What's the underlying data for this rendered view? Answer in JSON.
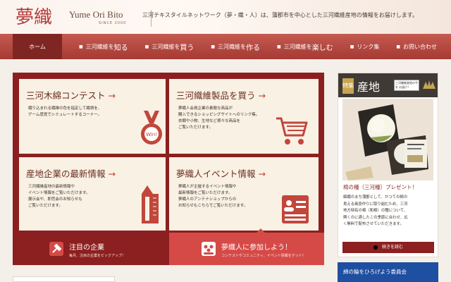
{
  "header": {
    "logo_kanji": "夢織人",
    "logo_name": "Yume Ori Bito",
    "logo_since": "SINCE 2000",
    "tagline": "三河テキスタイルネットワーク（夢・織・人）は、蒲郡市を中心とした三河織維産地の情報をお届けします。"
  },
  "nav": {
    "home": "ホーム",
    "items": [
      {
        "small": "三河織維を",
        "big": "知る"
      },
      {
        "small": "三河織維を",
        "big": "買う"
      },
      {
        "small": "三河織維を",
        "big": "作る"
      },
      {
        "small": "三河織維を",
        "big": "楽しむ"
      },
      {
        "small": "",
        "big": "リンク集"
      },
      {
        "small": "",
        "big": "お問い合わせ"
      }
    ]
  },
  "cards": {
    "c1": {
      "title": "三河木綿コンテスト",
      "desc": "織り込まれる織維の色を指定して織柄を、\nゲーム感覚でシミュレートするコーナー。",
      "icon_label": "Win!"
    },
    "c2": {
      "title": "三河織維製品を買う",
      "desc": "夢織人会員企業の素敵な商品が\n購入できるショッピングサイトへのリンク集。\n衣類や小物、生地など様々な商品を\nご覧いただけます。"
    },
    "c3": {
      "title": "産地企業の最新情報",
      "desc": "三河繊維産地の最新情報や\nイベント情報をご覧いただけます。\n展示会や、即売会のお知らせも\nご覧いただけます。"
    },
    "c4": {
      "title": "夢織人イベント情報",
      "desc": "夢織人が主催するイベント情報や\n最新情報をご覧いただけます。\n夢織人のアンテナショップからの\nお知らせもこちらでご覧いただけます。"
    }
  },
  "bottom": {
    "b1": {
      "title": "注目の企業",
      "sub": "毎月、注目の企業をピックアップ！"
    },
    "b2": {
      "title": "夢織人に参加しよう！",
      "sub": "コンテストやコミュニティ、イベント情報をゲット！"
    }
  },
  "sidebar": {
    "badge": "特集",
    "heading": "産地",
    "note": "三河織維産地の今を お届け！",
    "caption_title": "棉の種（三河種）プレゼント！",
    "caption_body": "綿織のまち蒲郡として、かつての棉の\n見える風景作りに取り組むため、三河\n地方特有の棉（和棉）の種について、\n興くのに適したこの季節に合わせ、広\nく無料で配布させていただきます。",
    "button": "続きを読む",
    "blue_banner": "綿の輪をひろげよう委員会"
  },
  "colors": {
    "nav": "#b04640",
    "panel": "#8c1f1f",
    "accent": "#d54a47",
    "card": "#f8f1e4",
    "banner": "#1f4fa0"
  }
}
